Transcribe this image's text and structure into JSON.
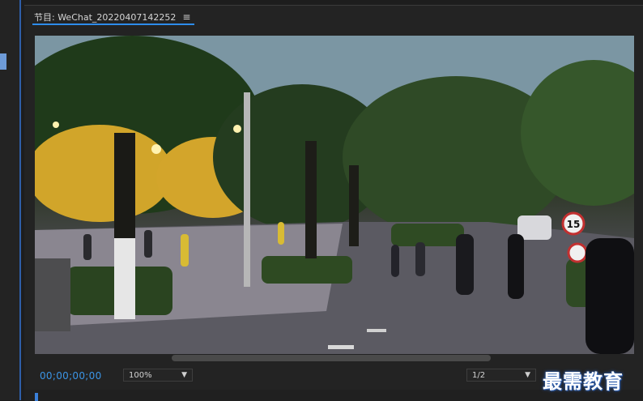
{
  "panel": {
    "tab_label": "节目: WeChat_20220407142252",
    "menu_icon": "hamburger-menu-icon"
  },
  "viewer": {
    "content": "video-frame-street-trees"
  },
  "controls": {
    "timecode": "00;00;00;00",
    "zoom": "100%",
    "resolution": "1/2"
  },
  "watermark": {
    "text": "最需教育"
  },
  "colors": {
    "accent": "#2d8ceb",
    "timecode": "#3b95e6",
    "background": "#232323"
  }
}
